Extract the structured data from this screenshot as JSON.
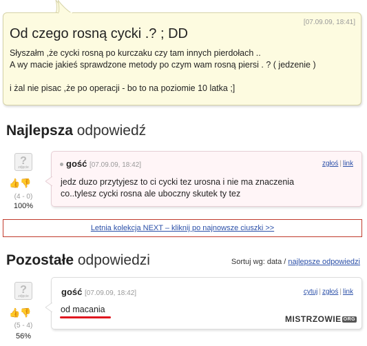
{
  "question": {
    "date": "[07.09.09, 18:41]",
    "title": "Od czego rosną cycki .? ; DD",
    "body_lines": [
      "Słyszałm ,że cycki rosną po kurczaku czy tam innych pierdołach ..",
      "A wy macie jakieś sprawdzone metody po czym wam rosną piersi . ? ( jedzenie )",
      "",
      "i żal nie pisac ,że po operacji - bo to na poziomie 10 latka ;]"
    ]
  },
  "best": {
    "title_bold": "Najlepsza",
    "title_light": "odpowiedź",
    "answer": {
      "author": "gość",
      "date": "[07.09.09, 18:42]",
      "links": [
        "zgłoś",
        "link"
      ],
      "text_lines": [
        "jedz duzo przytyjesz to ci cycki tez urosna i nie ma znaczenia",
        "co..tylesz cycki rosna ale uboczny skutek ty tez"
      ],
      "score": "(4 - 0)",
      "percent": "100%"
    }
  },
  "ad": {
    "text": "Letnia kolekcja NEXT – kliknij po najnowsze ciuszki >>"
  },
  "others": {
    "title_bold": "Pozostałe",
    "title_light": "odpowiedzi",
    "sort_label": "Sortuj wg: data /",
    "sort_link": "najlepsze odpowiedzi",
    "answer": {
      "author": "gość",
      "date": "[07.09.09, 18:42]",
      "links": [
        "cytuj",
        "zgłoś",
        "link"
      ],
      "text": "od macania",
      "score": "(5 - 4)",
      "percent": "56%"
    }
  },
  "avatar_label": "zdjęcie",
  "watermark": {
    "main": "MISTRZOWIE",
    "suffix": "ORG"
  },
  "colors": {
    "question_bg": "#fdfbe0",
    "best_bg": "#fff5f7",
    "link": "#2a4fa8",
    "ad_border": "#c0392b",
    "underline": "#e0141e"
  }
}
